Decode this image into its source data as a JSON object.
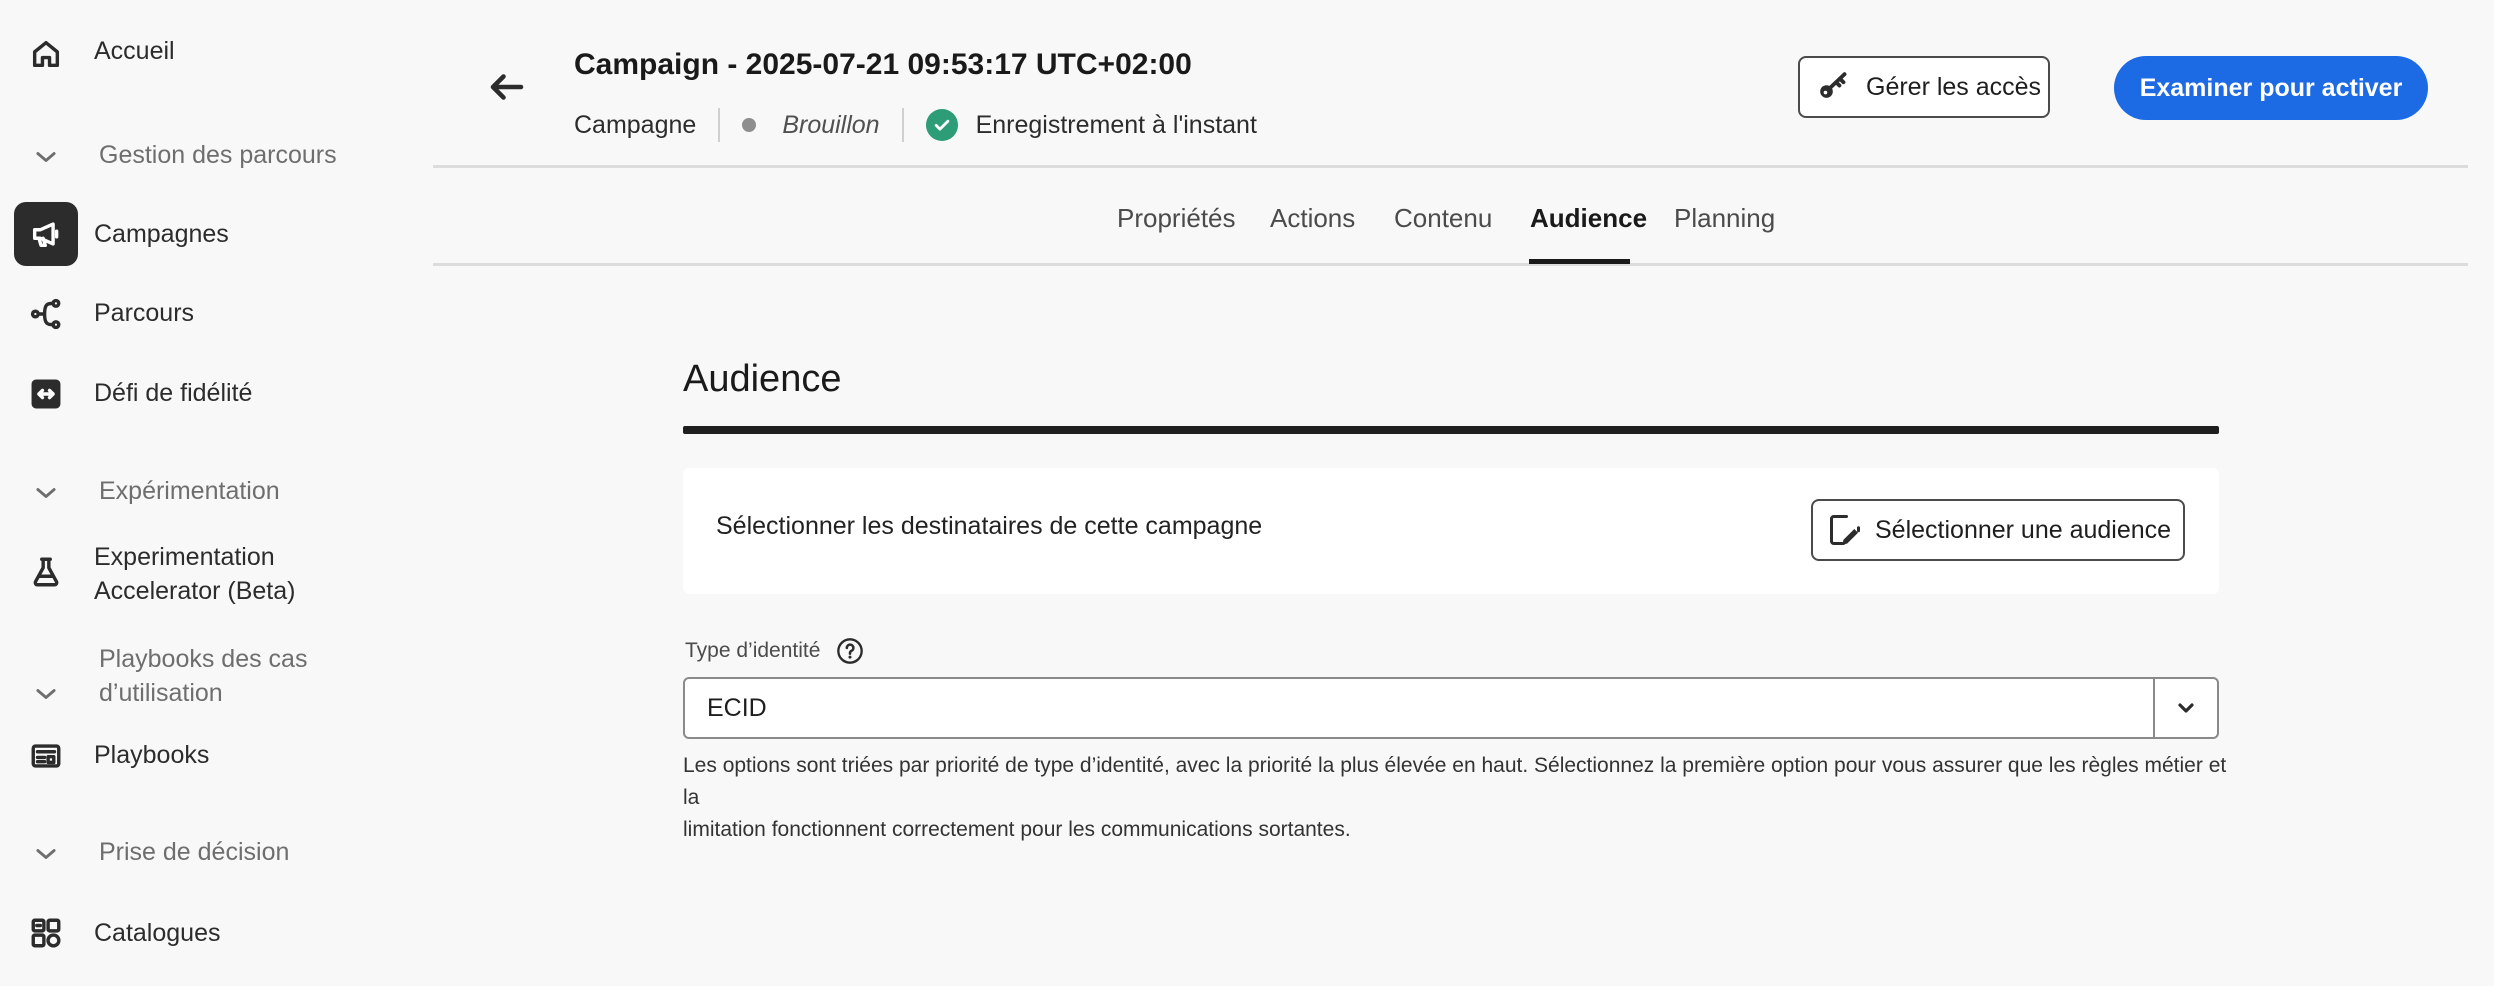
{
  "sidebar": {
    "home": "Accueil",
    "section_journeys": "Gestion des parcours",
    "campaigns": "Campagnes",
    "journeys": "Parcours",
    "loyalty": "Défi de fidélité",
    "section_experimentation": "Expérimentation",
    "exp_accelerator_line1": "Experimentation",
    "exp_accelerator_line2": "Accelerator (Beta)",
    "section_playbooks_line1": "Playbooks des cas",
    "section_playbooks_line2": "d’utilisation",
    "playbooks": "Playbooks",
    "section_decisioning": "Prise de décision",
    "catalogs": "Catalogues"
  },
  "header": {
    "title": "Campaign - 2025-07-21 09:53:17 UTC+02:00",
    "type": "Campagne",
    "status": "Brouillon",
    "save_status": "Enregistrement à l'instant",
    "manage_access_label": "Gérer les accès",
    "review_activate_label": "Examiner pour activer"
  },
  "tabs": [
    "Propriétés",
    "Actions",
    "Contenu",
    "Audience",
    "Planning"
  ],
  "active_tab": "Audience",
  "main": {
    "section_title": "Audience",
    "card_text": "Sélectionner les destinataires de cette campagne",
    "select_audience_label": "Sélectionner une audience",
    "identity_label": "Type d’identité",
    "identity_value": "ECID",
    "identity_help_line1": "Les options sont triées par priorité de type d’identité, avec la priorité la plus élevée en haut. Sélectionnez la première option pour vous assurer que les règles métier et la",
    "identity_help_line2": "limitation fonctionnent correctement pour les communications sortantes."
  },
  "colors": {
    "accent_blue": "#1d6ae5",
    "success_green": "#2d9d78",
    "draft_dot": "#8e8e8e"
  }
}
